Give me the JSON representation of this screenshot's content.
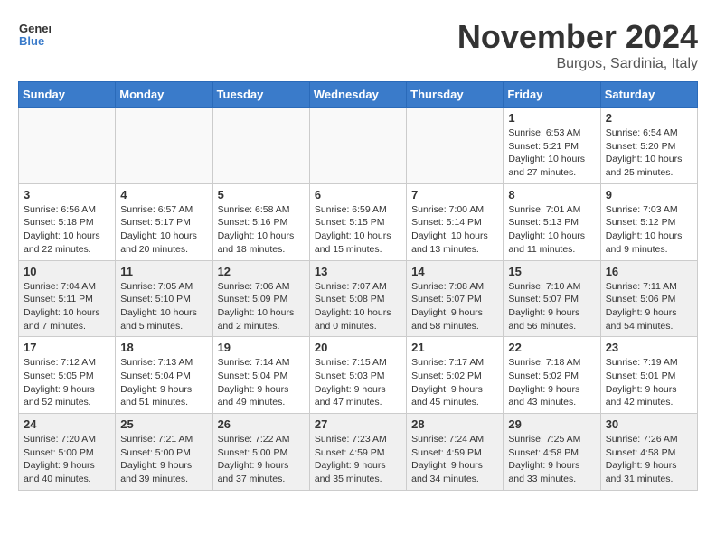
{
  "logo": {
    "general": "General",
    "blue": "Blue"
  },
  "title": "November 2024",
  "location": "Burgos, Sardinia, Italy",
  "headers": [
    "Sunday",
    "Monday",
    "Tuesday",
    "Wednesday",
    "Thursday",
    "Friday",
    "Saturday"
  ],
  "weeks": [
    [
      {
        "day": "",
        "info": ""
      },
      {
        "day": "",
        "info": ""
      },
      {
        "day": "",
        "info": ""
      },
      {
        "day": "",
        "info": ""
      },
      {
        "day": "",
        "info": ""
      },
      {
        "day": "1",
        "info": "Sunrise: 6:53 AM\nSunset: 5:21 PM\nDaylight: 10 hours and 27 minutes."
      },
      {
        "day": "2",
        "info": "Sunrise: 6:54 AM\nSunset: 5:20 PM\nDaylight: 10 hours and 25 minutes."
      }
    ],
    [
      {
        "day": "3",
        "info": "Sunrise: 6:56 AM\nSunset: 5:18 PM\nDaylight: 10 hours and 22 minutes."
      },
      {
        "day": "4",
        "info": "Sunrise: 6:57 AM\nSunset: 5:17 PM\nDaylight: 10 hours and 20 minutes."
      },
      {
        "day": "5",
        "info": "Sunrise: 6:58 AM\nSunset: 5:16 PM\nDaylight: 10 hours and 18 minutes."
      },
      {
        "day": "6",
        "info": "Sunrise: 6:59 AM\nSunset: 5:15 PM\nDaylight: 10 hours and 15 minutes."
      },
      {
        "day": "7",
        "info": "Sunrise: 7:00 AM\nSunset: 5:14 PM\nDaylight: 10 hours and 13 minutes."
      },
      {
        "day": "8",
        "info": "Sunrise: 7:01 AM\nSunset: 5:13 PM\nDaylight: 10 hours and 11 minutes."
      },
      {
        "day": "9",
        "info": "Sunrise: 7:03 AM\nSunset: 5:12 PM\nDaylight: 10 hours and 9 minutes."
      }
    ],
    [
      {
        "day": "10",
        "info": "Sunrise: 7:04 AM\nSunset: 5:11 PM\nDaylight: 10 hours and 7 minutes."
      },
      {
        "day": "11",
        "info": "Sunrise: 7:05 AM\nSunset: 5:10 PM\nDaylight: 10 hours and 5 minutes."
      },
      {
        "day": "12",
        "info": "Sunrise: 7:06 AM\nSunset: 5:09 PM\nDaylight: 10 hours and 2 minutes."
      },
      {
        "day": "13",
        "info": "Sunrise: 7:07 AM\nSunset: 5:08 PM\nDaylight: 10 hours and 0 minutes."
      },
      {
        "day": "14",
        "info": "Sunrise: 7:08 AM\nSunset: 5:07 PM\nDaylight: 9 hours and 58 minutes."
      },
      {
        "day": "15",
        "info": "Sunrise: 7:10 AM\nSunset: 5:07 PM\nDaylight: 9 hours and 56 minutes."
      },
      {
        "day": "16",
        "info": "Sunrise: 7:11 AM\nSunset: 5:06 PM\nDaylight: 9 hours and 54 minutes."
      }
    ],
    [
      {
        "day": "17",
        "info": "Sunrise: 7:12 AM\nSunset: 5:05 PM\nDaylight: 9 hours and 52 minutes."
      },
      {
        "day": "18",
        "info": "Sunrise: 7:13 AM\nSunset: 5:04 PM\nDaylight: 9 hours and 51 minutes."
      },
      {
        "day": "19",
        "info": "Sunrise: 7:14 AM\nSunset: 5:04 PM\nDaylight: 9 hours and 49 minutes."
      },
      {
        "day": "20",
        "info": "Sunrise: 7:15 AM\nSunset: 5:03 PM\nDaylight: 9 hours and 47 minutes."
      },
      {
        "day": "21",
        "info": "Sunrise: 7:17 AM\nSunset: 5:02 PM\nDaylight: 9 hours and 45 minutes."
      },
      {
        "day": "22",
        "info": "Sunrise: 7:18 AM\nSunset: 5:02 PM\nDaylight: 9 hours and 43 minutes."
      },
      {
        "day": "23",
        "info": "Sunrise: 7:19 AM\nSunset: 5:01 PM\nDaylight: 9 hours and 42 minutes."
      }
    ],
    [
      {
        "day": "24",
        "info": "Sunrise: 7:20 AM\nSunset: 5:00 PM\nDaylight: 9 hours and 40 minutes."
      },
      {
        "day": "25",
        "info": "Sunrise: 7:21 AM\nSunset: 5:00 PM\nDaylight: 9 hours and 39 minutes."
      },
      {
        "day": "26",
        "info": "Sunrise: 7:22 AM\nSunset: 5:00 PM\nDaylight: 9 hours and 37 minutes."
      },
      {
        "day": "27",
        "info": "Sunrise: 7:23 AM\nSunset: 4:59 PM\nDaylight: 9 hours and 35 minutes."
      },
      {
        "day": "28",
        "info": "Sunrise: 7:24 AM\nSunset: 4:59 PM\nDaylight: 9 hours and 34 minutes."
      },
      {
        "day": "29",
        "info": "Sunrise: 7:25 AM\nSunset: 4:58 PM\nDaylight: 9 hours and 33 minutes."
      },
      {
        "day": "30",
        "info": "Sunrise: 7:26 AM\nSunset: 4:58 PM\nDaylight: 9 hours and 31 minutes."
      }
    ]
  ]
}
